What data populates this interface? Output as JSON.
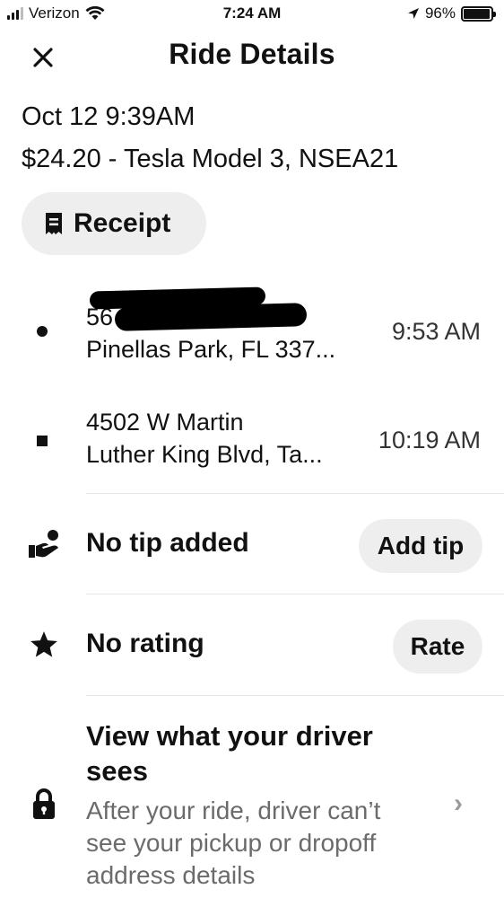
{
  "status_bar": {
    "carrier": "Verizon",
    "time": "7:24 AM",
    "battery": "96%",
    "battery_level": 0.96
  },
  "header": {
    "title": "Ride Details",
    "close_icon": "close-icon"
  },
  "trip": {
    "date": "Oct 12 9:39AM",
    "summary": "$24.20 - Tesla Model 3, NSEA21"
  },
  "receipt": {
    "label": "Receipt",
    "icon": "receipt-icon"
  },
  "stops": [
    {
      "line1": "56",
      "line2": "Pinellas Park, FL 337...",
      "time": "9:53 AM",
      "marker": "pickup-dot"
    },
    {
      "line1": "4502 W Martin",
      "line2": "Luther King Blvd, Ta...",
      "time": "10:19 AM",
      "marker": "dropoff-square"
    }
  ],
  "tip": {
    "label": "No tip added",
    "button": "Add tip",
    "icon": "hand-coin-icon"
  },
  "rating": {
    "label": "No rating",
    "button": "Rate",
    "icon": "star-icon"
  },
  "driver_view": {
    "title": "View what your driver sees",
    "body": "After your ride, driver can’t see your pickup or dropoff address details",
    "chevron": "›",
    "icon": "lock-icon"
  }
}
